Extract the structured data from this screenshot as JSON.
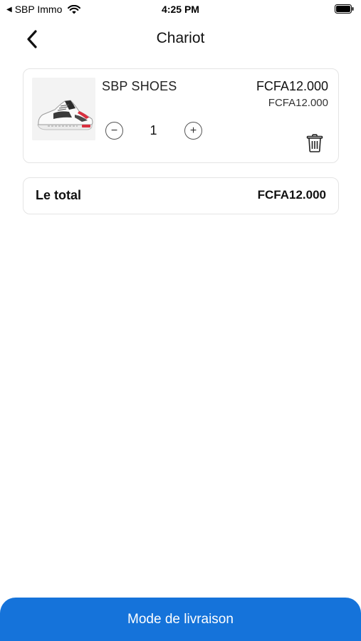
{
  "status_bar": {
    "back_app_label": "SBP Immo",
    "time": "4:25 PM"
  },
  "nav": {
    "title": "Chariot",
    "back_icon": "chevron-left-icon"
  },
  "cart": {
    "items": [
      {
        "name": "SBP SHOES",
        "price": "FCFA12.000",
        "unit_price": "FCFA12.000",
        "quantity": "1",
        "minus_label": "−",
        "plus_label": "+",
        "image": "sneaker-image"
      }
    ]
  },
  "total": {
    "label": "Le total",
    "value": "FCFA12.000"
  },
  "footer": {
    "button_label": "Mode de livraison"
  },
  "colors": {
    "accent": "#1573da",
    "card_border": "#e4e4e4"
  }
}
